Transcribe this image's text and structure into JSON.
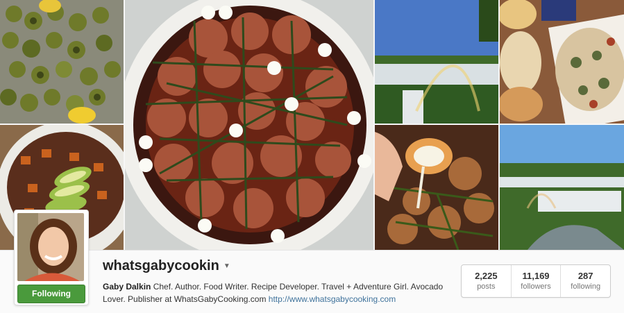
{
  "profile": {
    "username": "whatsgabycookin",
    "dropdown_icon": "caret-down-icon",
    "follow_button": "Following",
    "bio_name": "Gaby Dalkin",
    "bio_text": " Chef. Author. Food Writer. Recipe Developer. Travel + Adventure Girl. Avocado Lover. Publisher at WhatsGabyCooking.com ",
    "bio_link": "http://www.whatsgabycooking.com"
  },
  "stats": [
    {
      "value": "2,225",
      "label": "posts"
    },
    {
      "value": "11,169",
      "label": "followers"
    },
    {
      "value": "287",
      "label": "following"
    }
  ],
  "colors": {
    "follow_green": "#4a9a3c",
    "link_blue": "#3f729b"
  }
}
